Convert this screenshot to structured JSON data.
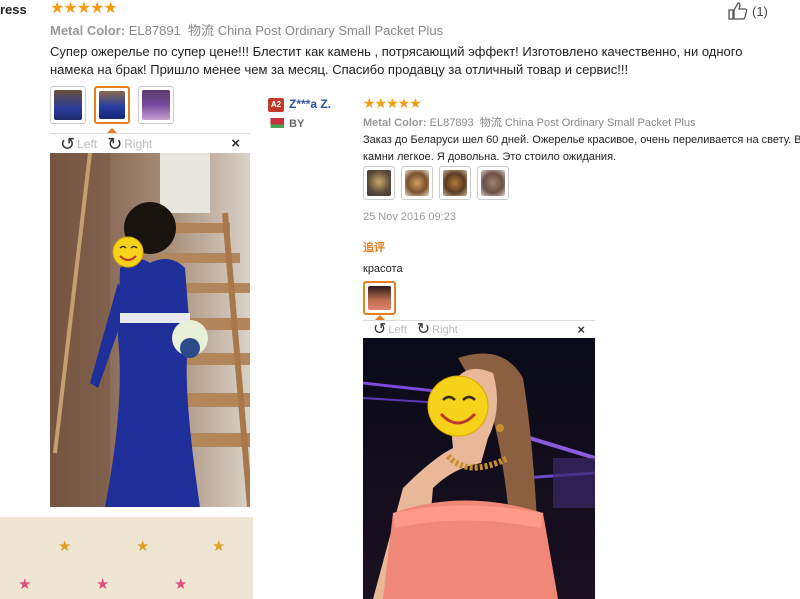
{
  "review1": {
    "title_cut": "ress",
    "stars": "★★★★★",
    "metal_color_label": "Metal Color:",
    "metal_color_value": "EL87891",
    "shipping_label": "物流",
    "shipping_value": "China Post Ordinary Small Packet Plus",
    "text": "Супер ожерелье по супер цене!!! Блестит как камень , потрясающий эффект! Изготовлено качественно, ни одного намека на брак! Пришло менее чем за месяц. Спасибо продавцу за отличный товар и сервис!!!",
    "helpful_count": "(1)",
    "viewer": {
      "left": "Left",
      "right": "Right",
      "close": "×"
    }
  },
  "reviewer": {
    "badge": "A2",
    "name": "Z***a Z.",
    "country": "BY"
  },
  "review2": {
    "stars": "★★★★★",
    "metal_color_label": "Metal Color:",
    "metal_color_value": "EL87893",
    "shipping_label": "物流",
    "shipping_value": "China Post Ordinary Small Packet Plus",
    "text": "Заказ до Беларуси шел 60 дней. Ожерелье красивое, очень переливается на свету. Все камни легкое. Я довольна. Это стоило ожидания.",
    "date": "25 Nov 2016 09:23",
    "followup_label": "追评",
    "followup_text": "красота",
    "viewer": {
      "left": "Left",
      "right": "Right",
      "close": "×"
    }
  },
  "colors": {
    "star": "#f39c12",
    "accent": "#e67e22",
    "name_link": "#2a4fa8",
    "badge_bg": "#c0392b"
  }
}
